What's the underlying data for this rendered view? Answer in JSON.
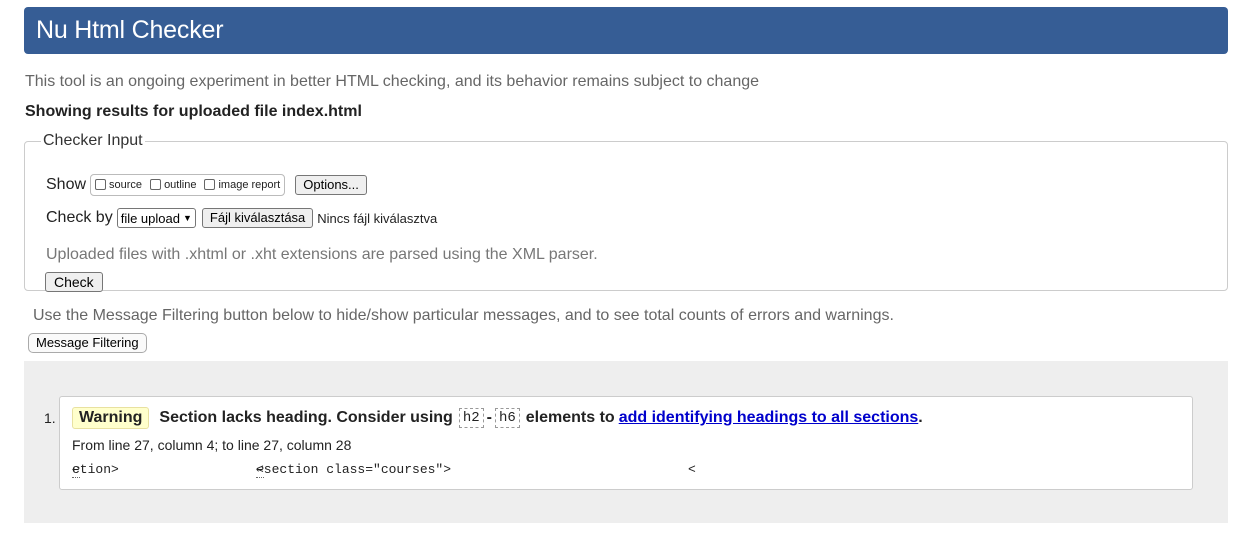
{
  "header": {
    "title": "Nu Html Checker"
  },
  "tagline": "This tool is an ongoing experiment in better HTML checking, and its behavior remains subject to change",
  "showing": "Showing results for uploaded file index.html",
  "checker_input": {
    "legend": "Checker Input",
    "show_label": "Show",
    "show_options": [
      {
        "label": "source",
        "checked": false
      },
      {
        "label": "outline",
        "checked": false
      },
      {
        "label": "image report",
        "checked": false
      }
    ],
    "options_button": "Options...",
    "check_by_label": "Check by",
    "check_by_selected": "file upload",
    "file_button": "Fájl kiválasztása",
    "file_status": "Nincs fájl kiválasztva",
    "note": "Uploaded files with .xhtml or .xht extensions are parsed using the XML parser.",
    "check_button": "Check"
  },
  "filter_note": "Use the Message Filtering button below to hide/show particular messages, and to see total counts of errors and warnings.",
  "filter_button": "Message Filtering",
  "messages": [
    {
      "number": "1.",
      "type": "Warning",
      "text_before": "Section lacks heading. Consider using",
      "el_1": "h2",
      "dash": "-",
      "el_2": "h6",
      "text_after": "elements to",
      "link_text": "add identifying headings to all sections",
      "period": ".",
      "location": "From line 27, column 4; to line 27, column 28",
      "extract_before": "ction>",
      "extract_highlight": "<section class=\"courses\">",
      "extract_after": "<",
      "return_glyph": "↩"
    }
  ]
}
